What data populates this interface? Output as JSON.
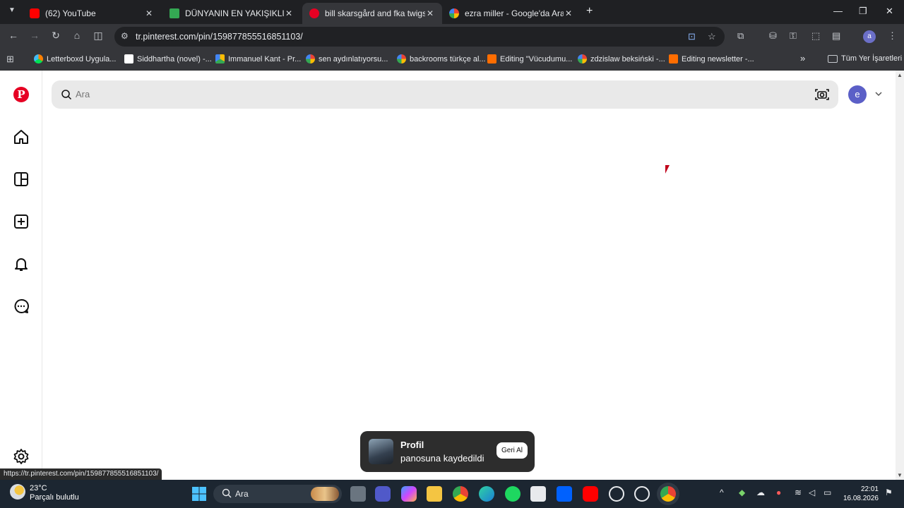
{
  "browser": {
    "tabs": [
      {
        "title": "(62) YouTube",
        "icon": "youtube-icon",
        "color": "#ff0000"
      },
      {
        "title": "DÜNYANIN EN YAKIŞIKLI ERKEĞ",
        "icon": "drive-icon",
        "color": "#34a853"
      },
      {
        "title": "bill skarsgård and fka twigs",
        "icon": "pinterest-icon",
        "color": "#e60023"
      },
      {
        "title": "ezra miller - Google'da Ara",
        "icon": "google-icon",
        "color": "#4285f4"
      }
    ],
    "address": "tr.pinterest.com/pin/159877855516851103/",
    "bookmarks": [
      {
        "label": "Letterboxd Uygula...",
        "icon": "letterboxd-icon",
        "color": "#40bcf4"
      },
      {
        "label": "Siddhartha (novel) -...",
        "icon": "wikipedia-icon",
        "color": "#ffffff"
      },
      {
        "label": "Immanuel Kant - Pr...",
        "icon": "drive-icon",
        "color": "#fbbc04"
      },
      {
        "label": "sen aydınlatıyorsu...",
        "icon": "google-icon",
        "color": "#4285f4"
      },
      {
        "label": "backrooms türkçe al...",
        "icon": "google-icon",
        "color": "#4285f4"
      },
      {
        "label": "Editing \"Vücudumu...",
        "icon": "blogger-icon",
        "color": "#ff6d00"
      },
      {
        "label": "zdzislaw beksiński -...",
        "icon": "google-icon",
        "color": "#4285f4"
      },
      {
        "label": "Editing newsletter -...",
        "icon": "blogger-icon",
        "color": "#ff6d00"
      }
    ],
    "all_bookmarks": "Tüm Yer İşaretleri",
    "profile_letter": "a",
    "status_url": "https://tr.pinterest.com/pin/159877855516851103/"
  },
  "pinterest": {
    "search_placeholder": "Ara",
    "avatar_letter": "e",
    "toast": {
      "title": "Profil",
      "message": "panosuna kaydedildi",
      "undo": "Geri Al"
    }
  },
  "taskbar": {
    "temperature": "23°C",
    "weather": "Parçalı bulutlu",
    "search": "Ara",
    "time": "22:01",
    "date": "16.08.2026"
  }
}
